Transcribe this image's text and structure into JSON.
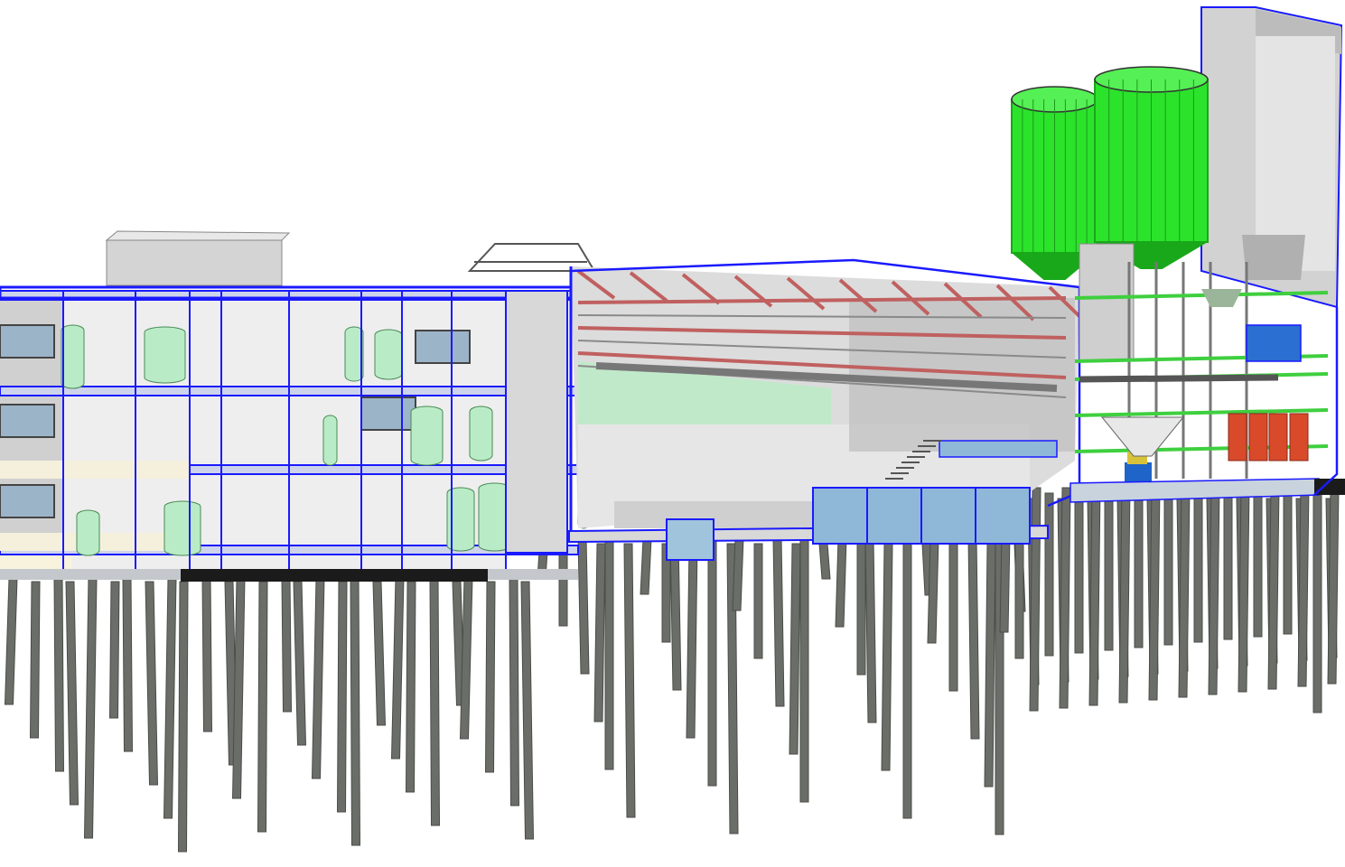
{
  "scene": {
    "kind": "3D BIM section view of industrial plant on pile foundation",
    "colors": {
      "background": "#ffffff",
      "section_outline": "#1a1aff",
      "pile": "#6b6e68",
      "pile_dark": "#4a4c47",
      "wall_light": "#e6e6e6",
      "wall_mid": "#c8c8c8",
      "silo": "#2be32b",
      "silo_dark": "#19a819",
      "glass": "#b9ecc6",
      "water": "#8fb8d8",
      "truss_red": "#c06060",
      "stair_green": "#3fcf3f",
      "container_red": "#d84a2a",
      "machine_blue": "#2a6fd1",
      "slab": "#fbf6e3"
    }
  }
}
